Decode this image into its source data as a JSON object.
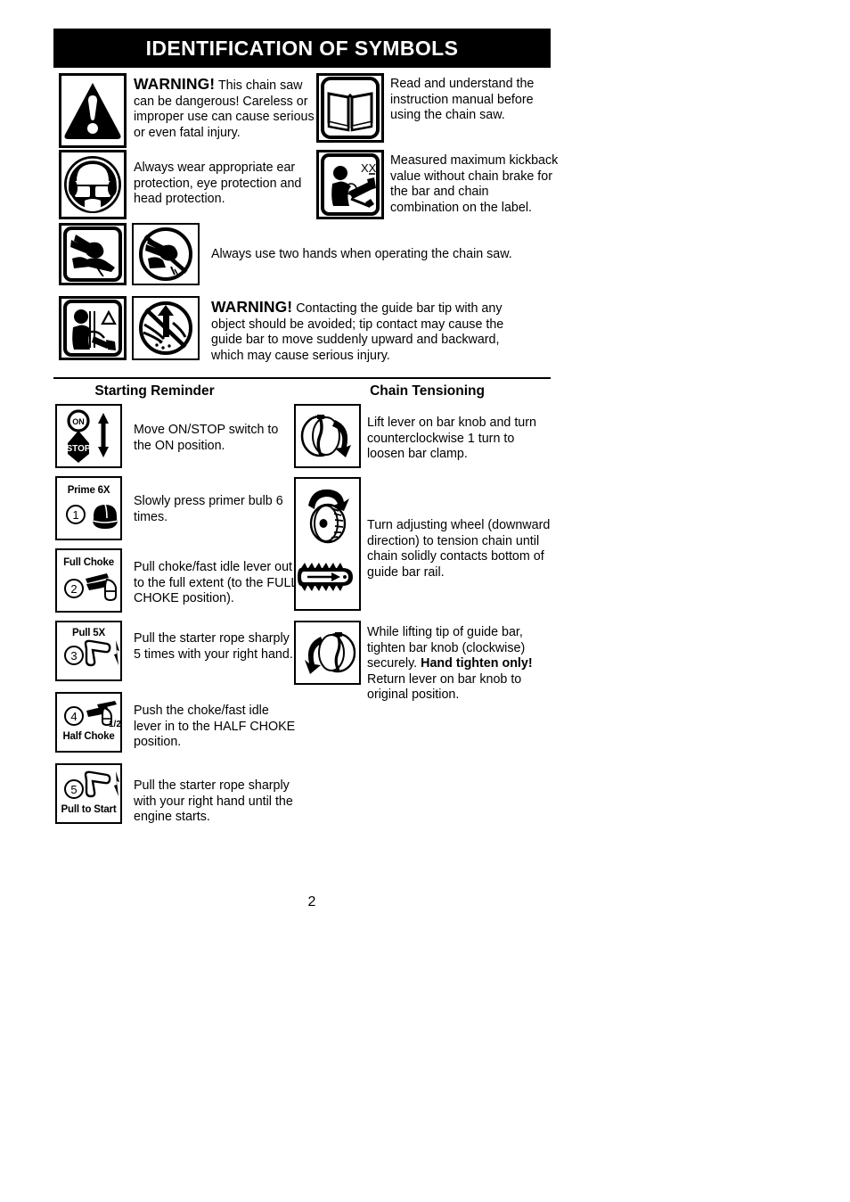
{
  "document": {
    "header_title": "IDENTIFICATION OF SYMBOLS",
    "page_number": "2"
  },
  "symbols": [
    {
      "icon": "warning-triangle-exclamation-icon",
      "lead": "WARNING!",
      "text": "This chain saw can be dangerous!  Careless or improper use can cause serious or even fatal injury."
    },
    {
      "icon": "open-book-manual-icon",
      "lead": "",
      "text": "Read and understand the instruction manual before using the chain saw."
    },
    {
      "icon": "head-ear-eye-protection-icon",
      "lead": "",
      "text": "Always wear appropriate ear protection, eye protection and head protection."
    },
    {
      "icon": "measured-kickback-value-icon",
      "icon_text": "XX",
      "lead": "",
      "text": "Measured maximum kickback value without chain brake for the bar and chain combination on the label."
    },
    {
      "icon": "two-hands-operation-icon",
      "icon2": "one-hand-prohibited-icon",
      "lead": "",
      "text": "Always use two hands when operating the chain saw."
    },
    {
      "icon": "kickback-operator-icon",
      "icon2": "bar-tip-contact-prohibited-icon",
      "lead": "WARNING!",
      "text": "Contacting the guide bar tip with any object should be avoided; tip contact may cause the guide bar to move suddenly upward and backward, which may cause serious injury."
    }
  ],
  "starting_reminder": {
    "heading": "Starting Reminder",
    "steps": [
      {
        "icon": "on-stop-switch-icon",
        "badge_on": "ON",
        "badge_stop": "STOP",
        "number": "",
        "label": "",
        "text": "Move ON/STOP switch to the ON position."
      },
      {
        "icon": "primer-bulb-icon",
        "number": "1",
        "label": "Prime 6X",
        "text": "Slowly press primer bulb 6 times."
      },
      {
        "icon": "full-choke-lever-icon",
        "number": "2",
        "label": "Full Choke",
        "text": "Pull choke/fast idle lever out to the full extent (to the FULL CHOKE position)."
      },
      {
        "icon": "starter-rope-pull-icon",
        "number": "3",
        "label": "Pull 5X",
        "text": "Pull the starter rope sharply 5 times with your right hand."
      },
      {
        "icon": "half-choke-lever-icon",
        "number": "4",
        "label": "Half Choke",
        "sublabel": "1/2",
        "text": "Push the choke/fast idle lever in to the HALF CHOKE position."
      },
      {
        "icon": "pull-to-start-icon",
        "number": "5",
        "label": "Pull to Start",
        "text": "Pull the starter rope sharply with your right hand until the engine starts."
      }
    ]
  },
  "chain_tensioning": {
    "heading": "Chain Tensioning",
    "steps": [
      {
        "icon": "bar-knob-counterclockwise-icon",
        "text": "Lift lever on bar knob and turn counterclockwise 1 turn to loosen bar clamp."
      },
      {
        "icon": "adjusting-wheel-icon",
        "icon2": "guide-bar-chain-icon",
        "text": "Turn adjusting wheel (downward direction) to tension chain until chain solidly contacts bottom of guide bar rail."
      },
      {
        "icon": "bar-knob-clockwise-icon",
        "text_part1": "While lifting tip of guide bar, tighten bar knob (clockwise) securely. ",
        "text_bold": "Hand tighten only!",
        "text_part2": " Return lever on bar knob to original position."
      }
    ]
  }
}
